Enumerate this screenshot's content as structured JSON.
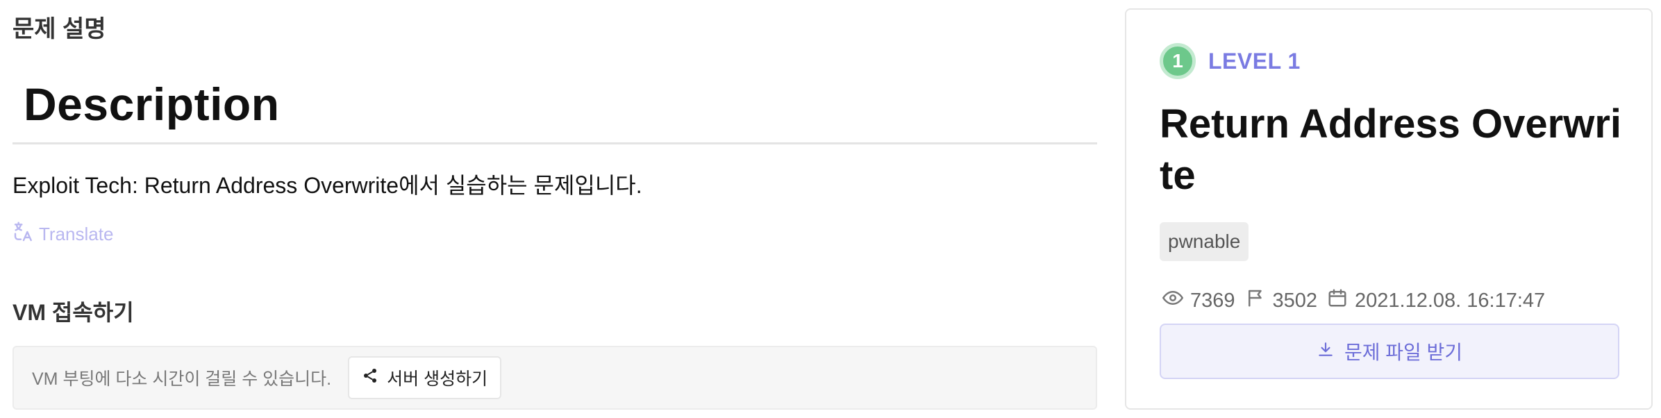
{
  "left": {
    "section_label": "문제 설명",
    "description_heading": "Description",
    "description_text": "Exploit Tech: Return Address Overwrite에서 실습하는 문제입니다.",
    "translate_label": "Translate",
    "vm_heading": "VM 접속하기",
    "vm_note": "VM 부팅에 다소 시간이 걸릴 수 있습니다.",
    "server_button_label": "서버 생성하기"
  },
  "card": {
    "level_number": "1",
    "level_label": "LEVEL 1",
    "title": "Return Address Overwrite",
    "tag": "pwnable",
    "views": "7369",
    "solves": "3502",
    "date": "2021.12.08. 16:17:47",
    "download_label": "문제 파일 받기"
  },
  "colors": {
    "accent": "#7a7be2",
    "level_badge": "#6dc88b",
    "translate": "#b9b7f0"
  },
  "icons": [
    "translate-icon",
    "share-icon",
    "eye-icon",
    "flag-icon",
    "calendar-icon",
    "download-icon"
  ]
}
